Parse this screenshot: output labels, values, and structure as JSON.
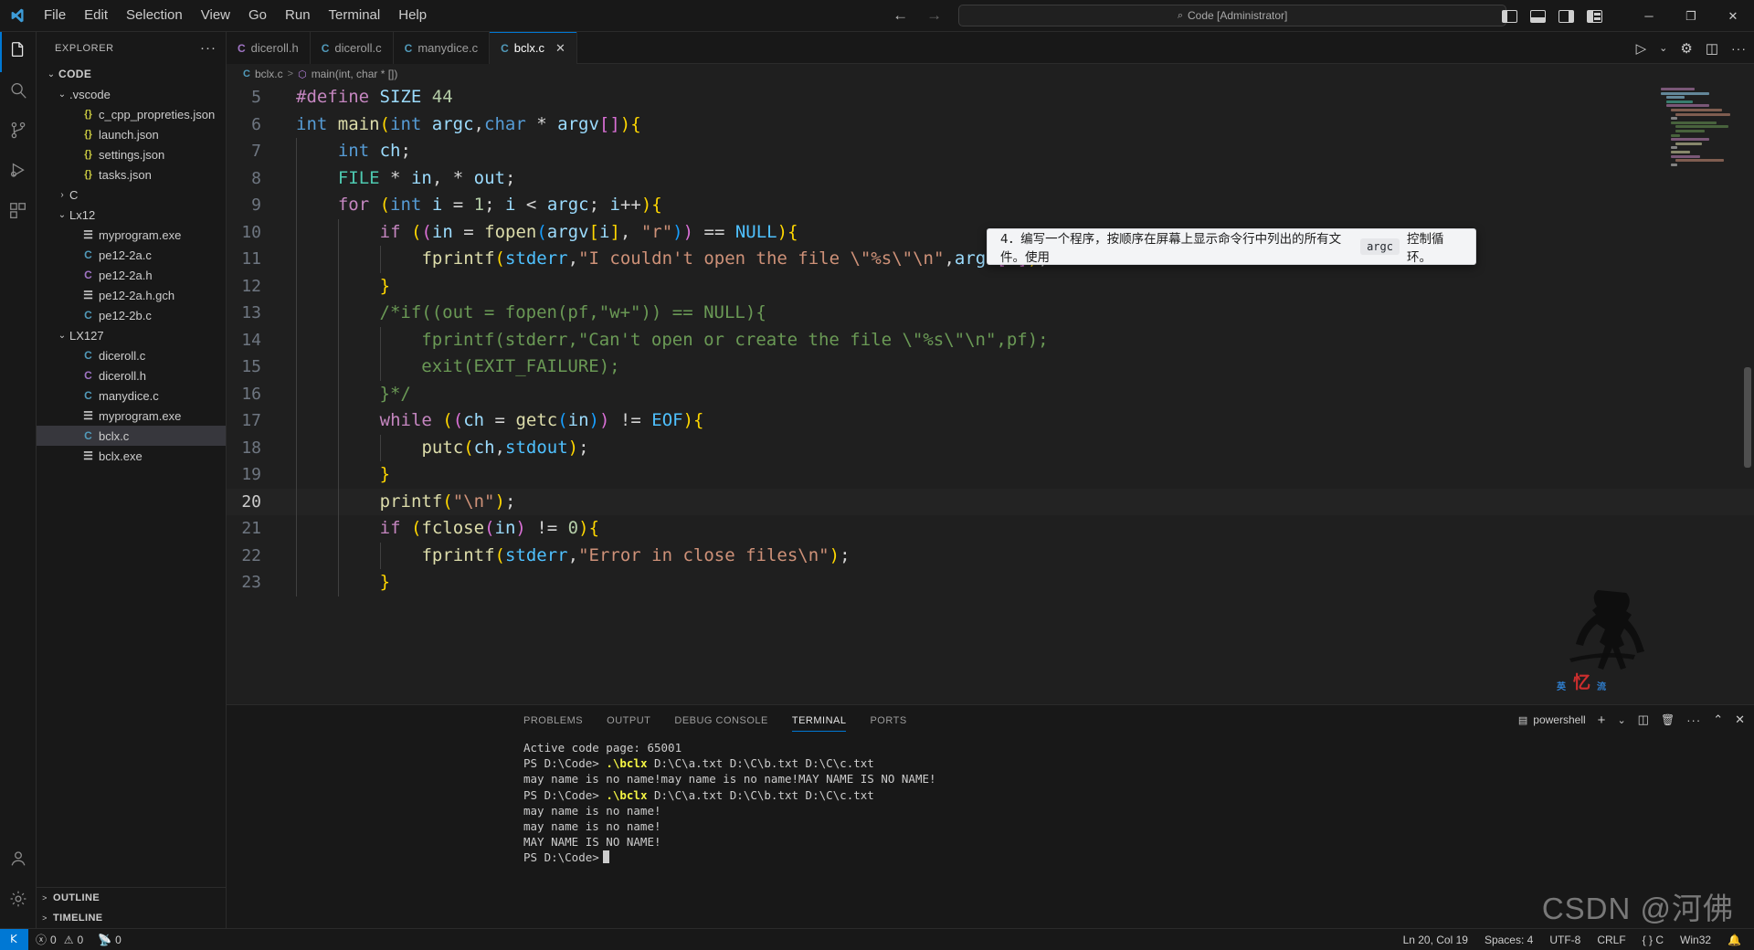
{
  "titlebar": {
    "title": "Code [Administrator]",
    "search_icon": "search-icon",
    "menus": [
      "File",
      "Edit",
      "Selection",
      "View",
      "Go",
      "Run",
      "Terminal",
      "Help"
    ],
    "back_arrow": "←",
    "forward_arrow": "→",
    "layout_icons": [
      "toggle-primary-sidebar",
      "toggle-panel",
      "toggle-secondary-sidebar",
      "customize-layout"
    ],
    "window_controls": {
      "minimize": "─",
      "maximize": "❐",
      "close": "✕"
    }
  },
  "activitybar": {
    "items": [
      {
        "name": "explorer",
        "icon": "files-icon",
        "active": true
      },
      {
        "name": "search",
        "icon": "search-icon",
        "active": false
      },
      {
        "name": "source-control",
        "icon": "source-control-icon",
        "active": false
      },
      {
        "name": "run-and-debug",
        "icon": "debug-icon",
        "active": false
      },
      {
        "name": "extensions",
        "icon": "extensions-icon",
        "active": false
      }
    ],
    "bottom": [
      {
        "name": "accounts",
        "icon": "account-icon"
      },
      {
        "name": "manage",
        "icon": "gear-icon"
      }
    ]
  },
  "sidebar": {
    "header": "EXPLORER",
    "more_actions": "···",
    "tree": [
      {
        "label": "CODE",
        "kind": "root",
        "indent": 0,
        "chev": "v",
        "icon": ""
      },
      {
        "label": ".vscode",
        "kind": "folder",
        "indent": 1,
        "chev": "v",
        "icon": ""
      },
      {
        "label": "c_cpp_propreties.json",
        "kind": "file",
        "indent": 2,
        "chev": "",
        "icon": "json"
      },
      {
        "label": "launch.json",
        "kind": "file",
        "indent": 2,
        "chev": "",
        "icon": "json"
      },
      {
        "label": "settings.json",
        "kind": "file",
        "indent": 2,
        "chev": "",
        "icon": "json"
      },
      {
        "label": "tasks.json",
        "kind": "file",
        "indent": 2,
        "chev": "",
        "icon": "json"
      },
      {
        "label": "C",
        "kind": "folder",
        "indent": 1,
        "chev": ">",
        "icon": ""
      },
      {
        "label": "Lx12",
        "kind": "folder",
        "indent": 1,
        "chev": "v",
        "icon": ""
      },
      {
        "label": "myprogram.exe",
        "kind": "file",
        "indent": 2,
        "chev": "",
        "icon": "exe"
      },
      {
        "label": "pe12-2a.c",
        "kind": "file",
        "indent": 2,
        "chev": "",
        "icon": "c"
      },
      {
        "label": "pe12-2a.h",
        "kind": "file",
        "indent": 2,
        "chev": "",
        "icon": "h"
      },
      {
        "label": "pe12-2a.h.gch",
        "kind": "file",
        "indent": 2,
        "chev": "",
        "icon": "exe"
      },
      {
        "label": "pe12-2b.c",
        "kind": "file",
        "indent": 2,
        "chev": "",
        "icon": "c"
      },
      {
        "label": "LX127",
        "kind": "folder",
        "indent": 1,
        "chev": "v",
        "icon": ""
      },
      {
        "label": "diceroll.c",
        "kind": "file",
        "indent": 2,
        "chev": "",
        "icon": "c"
      },
      {
        "label": "diceroll.h",
        "kind": "file",
        "indent": 2,
        "chev": "",
        "icon": "h"
      },
      {
        "label": "manydice.c",
        "kind": "file",
        "indent": 2,
        "chev": "",
        "icon": "c"
      },
      {
        "label": "myprogram.exe",
        "kind": "file",
        "indent": 2,
        "chev": "",
        "icon": "exe"
      },
      {
        "label": "bclx.c",
        "kind": "file",
        "indent": 2,
        "chev": "",
        "icon": "c",
        "selected": true
      },
      {
        "label": "bclx.exe",
        "kind": "file",
        "indent": 2,
        "chev": "",
        "icon": "exe"
      }
    ],
    "sections": [
      {
        "label": "OUTLINE",
        "chev": ">"
      },
      {
        "label": "TIMELINE",
        "chev": ">"
      }
    ]
  },
  "editor": {
    "tabs": [
      {
        "label": "diceroll.h",
        "icon_letter": "C",
        "icon_color": "#a074c4",
        "active": false,
        "closable": false
      },
      {
        "label": "diceroll.c",
        "icon_letter": "C",
        "icon_color": "#519aba",
        "active": false,
        "closable": false
      },
      {
        "label": "manydice.c",
        "icon_letter": "C",
        "icon_color": "#519aba",
        "active": false,
        "closable": false
      },
      {
        "label": "bclx.c",
        "icon_letter": "C",
        "icon_color": "#519aba",
        "active": true,
        "closable": true
      }
    ],
    "close_glyph": "✕",
    "actions": [
      {
        "name": "run-code-button",
        "glyph": "▷"
      },
      {
        "name": "run-options-chevron-icon",
        "glyph": "⌄"
      },
      {
        "name": "settings-gear-icon",
        "glyph": "⚙"
      },
      {
        "name": "split-editor-right-icon",
        "glyph": "◫"
      },
      {
        "name": "more-actions-icon",
        "glyph": "···"
      }
    ],
    "breadcrumb": {
      "file_icon_letter": "C",
      "file": "bclx.c",
      "separator": ">",
      "symbol_icon": "symbol-method-icon",
      "symbol": "main(int, char * [])"
    },
    "first_line_number": 5,
    "current_line": 20,
    "lines": [
      {
        "n": 5,
        "text": "#define SIZE 44"
      },
      {
        "n": 6,
        "text": "int main(int argc,char * argv[]){"
      },
      {
        "n": 7,
        "text": "    int ch;"
      },
      {
        "n": 8,
        "text": "    FILE * in, * out;"
      },
      {
        "n": 9,
        "text": "    for (int i = 1; i < argc; i++){"
      },
      {
        "n": 10,
        "text": "        if ((in = fopen(argv[i], \"r\")) == NULL){"
      },
      {
        "n": 11,
        "text": "            fprintf(stderr,\"I couldn't open the file \\\"%s\\\"\\n\",argv[i]);"
      },
      {
        "n": 12,
        "text": "        }"
      },
      {
        "n": 13,
        "text": "        /*if((out = fopen(pf,\"w+\")) == NULL){"
      },
      {
        "n": 14,
        "text": "            fprintf(stderr,\"Can't open or create the file \\\"%s\\\"\\n\",pf);"
      },
      {
        "n": 15,
        "text": "            exit(EXIT_FAILURE);"
      },
      {
        "n": 16,
        "text": "        }*/"
      },
      {
        "n": 17,
        "text": "        while ((ch = getc(in)) != EOF){"
      },
      {
        "n": 18,
        "text": "            putc(ch,stdout);"
      },
      {
        "n": 19,
        "text": "        }"
      },
      {
        "n": 20,
        "text": "        printf(\"\\n\");"
      },
      {
        "n": 21,
        "text": "        if (fclose(in) != 0){"
      },
      {
        "n": 22,
        "text": "            fprintf(stderr,\"Error in close files\\n\");"
      },
      {
        "n": 23,
        "text": "        }"
      }
    ]
  },
  "hovercard": {
    "prefix": "4．编写一个程序，按顺序在屏幕上显示命令行中列出的所有文件。使用",
    "code": "argc",
    "suffix": "控制循环。"
  },
  "panel": {
    "tabs": [
      {
        "label": "PROBLEMS",
        "active": false
      },
      {
        "label": "OUTPUT",
        "active": false
      },
      {
        "label": "DEBUG CONSOLE",
        "active": false
      },
      {
        "label": "TERMINAL",
        "active": true
      },
      {
        "label": "PORTS",
        "active": false
      }
    ],
    "terminal_name": "powershell",
    "actions": [
      {
        "name": "new-terminal-button",
        "glyph": "+"
      },
      {
        "name": "terminal-profile-chevron-icon",
        "glyph": "⌄"
      },
      {
        "name": "split-terminal-button",
        "glyph": "◫"
      },
      {
        "name": "kill-terminal-button",
        "glyph": "🗑"
      },
      {
        "name": "panel-more-actions-icon",
        "glyph": "···"
      },
      {
        "name": "maximize-panel-icon",
        "glyph": "⌃"
      },
      {
        "name": "close-panel-icon",
        "glyph": "✕"
      }
    ],
    "terminal_lines": [
      [
        {
          "t": "Active code page: 65001",
          "c": "plain"
        }
      ],
      [
        {
          "t": "PS D:\\Code> ",
          "c": "plain"
        },
        {
          "t": ".\\bclx",
          "c": "yellow"
        },
        {
          "t": " D:\\C\\a.txt D:\\C\\b.txt D:\\C\\c.txt",
          "c": "plain"
        }
      ],
      [
        {
          "t": "may name is no name!may name is no name!MAY NAME IS NO NAME!",
          "c": "plain"
        }
      ],
      [
        {
          "t": "PS D:\\Code> ",
          "c": "plain"
        },
        {
          "t": ".\\bclx",
          "c": "yellow"
        },
        {
          "t": " D:\\C\\a.txt D:\\C\\b.txt D:\\C\\c.txt",
          "c": "plain"
        }
      ],
      [
        {
          "t": "may name is no name!",
          "c": "plain"
        }
      ],
      [
        {
          "t": "may name is no name!",
          "c": "plain"
        }
      ],
      [
        {
          "t": "MAY NAME IS NO NAME!",
          "c": "plain"
        }
      ],
      [
        {
          "t": "PS D:\\Code>",
          "c": "plain",
          "cursor": true
        }
      ]
    ]
  },
  "statusbar": {
    "remote_icon": "remote-window-icon",
    "errors": "0",
    "warnings": "0",
    "ports": "0",
    "right": [
      {
        "name": "editor-position",
        "label": "Ln 20, Col 19"
      },
      {
        "name": "indentation",
        "label": "Spaces: 4"
      },
      {
        "name": "encoding",
        "label": "UTF-8"
      },
      {
        "name": "eol",
        "label": "CRLF"
      },
      {
        "name": "language-mode",
        "label": "{ } C"
      },
      {
        "name": "platform",
        "label": "Win32"
      },
      {
        "name": "notifications-bell-icon",
        "label": "🔔"
      }
    ]
  },
  "watermark": "CSDN @河佛",
  "colors": {
    "accent": "#0078d4",
    "editor_bg": "#1f1f1f",
    "chrome_bg": "#181818",
    "selection": "#37373d"
  }
}
